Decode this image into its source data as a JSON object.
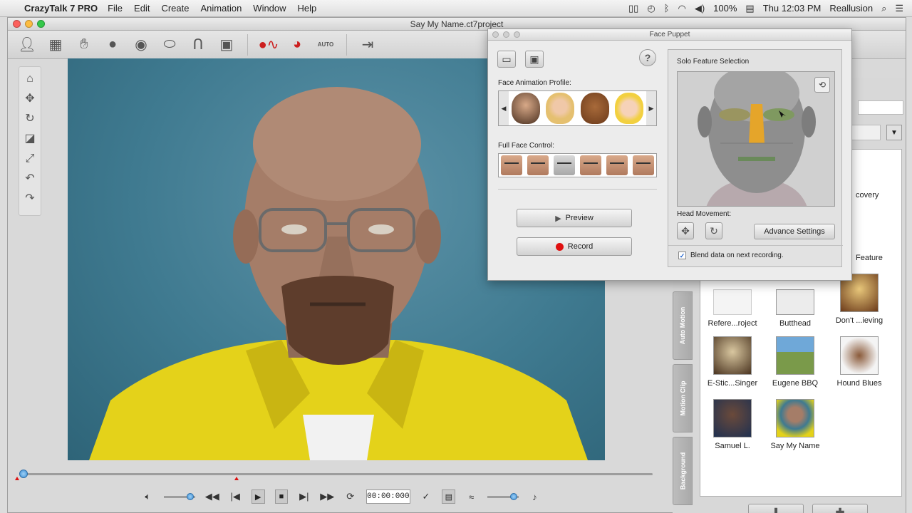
{
  "menubar": {
    "app_name": "CrazyTalk 7 PRO",
    "menus": [
      "File",
      "Edit",
      "Create",
      "Animation",
      "Window",
      "Help"
    ],
    "battery": "100%",
    "clock": "Thu 12:03 PM",
    "user": "Reallusion"
  },
  "window": {
    "title": "Say My Name.ct7project"
  },
  "toolbar": {
    "auto_label": "AUTO"
  },
  "transport": {
    "timecode": "00:00:000",
    "timeline_position": 0.0
  },
  "face_puppet": {
    "title": "Face Puppet",
    "profile_label": "Face Animation Profile:",
    "full_face_label": "Full Face Control:",
    "preview_label": "Preview",
    "record_label": "Record",
    "solo_title": "Solo Feature Selection",
    "head_movement_label": "Head Movement:",
    "advance_settings_label": "Advance Settings",
    "blend_label": "Blend data on next recording.",
    "blend_checked": true,
    "help_label": "?"
  },
  "right_panel": {
    "tabs": [
      "Auto Motion",
      "Motion Clip",
      "Background"
    ],
    "partial_labels": [
      "covery",
      "Feature"
    ],
    "items": [
      {
        "label": "Refere...roject"
      },
      {
        "label": "Butthead"
      },
      {
        "label": "Don't ...ieving"
      },
      {
        "label": "E-Stic...Singer"
      },
      {
        "label": "Eugene BBQ"
      },
      {
        "label": "Hound Blues"
      },
      {
        "label": "Samuel L."
      },
      {
        "label": "Say My Name"
      }
    ]
  },
  "colors": {
    "accent_blue": "#3b8fd6",
    "record_red": "#e01010",
    "viewport_bg": "#3f7a90",
    "jacket_yellow": "#e4d21a"
  }
}
